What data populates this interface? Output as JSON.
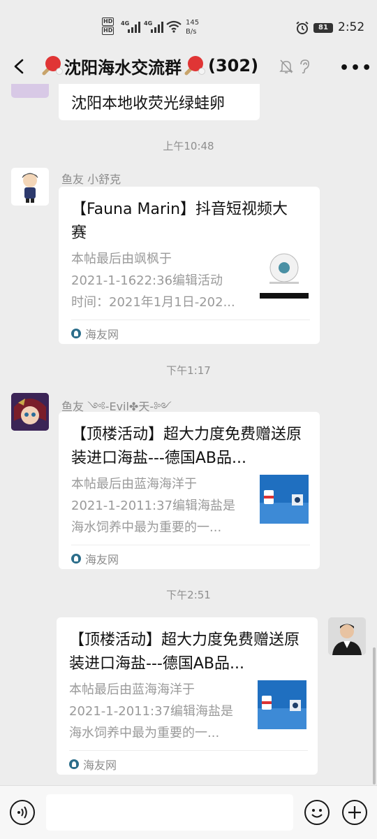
{
  "status_bar": {
    "hd1": "HD",
    "hd2": "HD",
    "net1": "4G",
    "net2": "4G",
    "speed_value": "145",
    "speed_unit": "B/s",
    "battery": "81",
    "time": "2:52"
  },
  "header": {
    "title": "沈阳海水交流群",
    "count": "(302)"
  },
  "messages": {
    "prev_text": "沈阳本地收荧光绿蛙卵",
    "ts1": "上午10:48",
    "m1_sender": "鱼友 小舒克",
    "m1_title": "【Fauna Marin】抖音短视频大赛",
    "m1_desc1": "本帖最后由飒枫于",
    "m1_desc2": "2021-1-1622:36编辑活动",
    "m1_desc3": "时间：2021年1月1日-202...",
    "m1_source": "海友网",
    "ts2": "下午1:17",
    "m2_sender": "鱼友 ༺-Evil✤天-༻",
    "m2_title": "【顶楼活动】超大力度免费赠送原装进口海盐---德国AB品...",
    "m2_desc1": "本帖最后由蓝海海洋于",
    "m2_desc2": "2021-1-2011:37编辑海盐是",
    "m2_desc3": "海水饲养中最为重要的一...",
    "m2_source": "海友网",
    "ts3": "下午2:51",
    "m3_title": "【顶楼活动】超大力度免费赠送原装进口海盐---德国AB品...",
    "m3_desc1": "本帖最后由蓝海海洋于",
    "m3_desc2": "2021-1-2011:37编辑海盐是",
    "m3_desc3": "海水饲养中最为重要的一...",
    "m3_source": "海友网"
  },
  "input": {
    "placeholder": ""
  },
  "icons": {
    "back": "back-arrow-icon",
    "mute": "mute-bell-icon",
    "ear": "earpiece-icon",
    "more": "more-icon",
    "voice": "voice-icon",
    "emoji": "emoji-icon",
    "plus": "plus-icon"
  },
  "colors": {
    "background": "#ededed",
    "bubble": "#ffffff",
    "link_source": "#2b6d8a"
  }
}
